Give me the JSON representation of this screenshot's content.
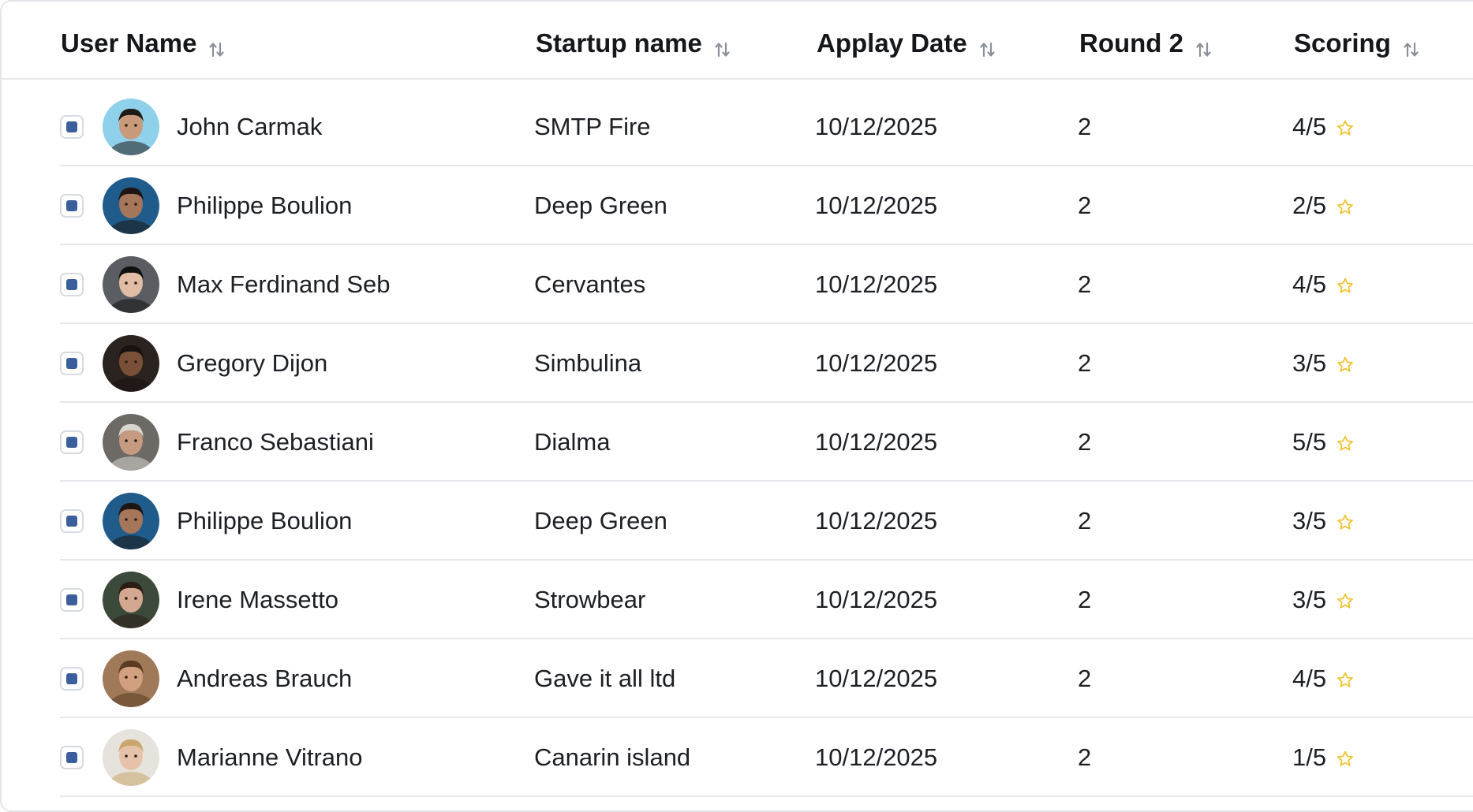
{
  "table": {
    "columns": [
      {
        "key": "user",
        "label": "User Name"
      },
      {
        "key": "startup",
        "label": "Startup name"
      },
      {
        "key": "date",
        "label": "Applay Date"
      },
      {
        "key": "round",
        "label": "Round 2"
      },
      {
        "key": "scoring",
        "label": "Scoring"
      }
    ],
    "rows": [
      {
        "name": "John Carmak",
        "startup": "SMTP Fire",
        "date": "10/12/2025",
        "round": "2",
        "score": "4/5",
        "avatar": {
          "bg": "#8fd0ea",
          "skin": "#c99a7a",
          "hair": "#1e1a17"
        }
      },
      {
        "name": "Philippe Boulion",
        "startup": "Deep Green",
        "date": "10/12/2025",
        "round": "2",
        "score": "2/5",
        "avatar": {
          "bg": "#1f5c8c",
          "skin": "#a6765a",
          "hair": "#1c1512"
        }
      },
      {
        "name": "Max Ferdinand Seb",
        "startup": "Cervantes",
        "date": "10/12/2025",
        "round": "2",
        "score": "4/5",
        "avatar": {
          "bg": "#5a5e62",
          "skin": "#e2bda5",
          "hair": "#111111"
        }
      },
      {
        "name": "Gregory Dijon",
        "startup": "Simbulina",
        "date": "10/12/2025",
        "round": "2",
        "score": "3/5",
        "avatar": {
          "bg": "#2a2320",
          "skin": "#7a5038",
          "hair": "#1a1210"
        }
      },
      {
        "name": "Franco Sebastiani",
        "startup": "Dialma",
        "date": "10/12/2025",
        "round": "2",
        "score": "5/5",
        "avatar": {
          "bg": "#6d6a66",
          "skin": "#c49a80",
          "hair": "#d8d4cf"
        }
      },
      {
        "name": "Philippe Boulion",
        "startup": "Deep Green",
        "date": "10/12/2025",
        "round": "2",
        "score": "3/5",
        "avatar": {
          "bg": "#1f5c8c",
          "skin": "#a6765a",
          "hair": "#1c1512"
        }
      },
      {
        "name": "Irene Massetto",
        "startup": "Strowbear",
        "date": "10/12/2025",
        "round": "2",
        "score": "3/5",
        "avatar": {
          "bg": "#3c4a3c",
          "skin": "#d4a890",
          "hair": "#2b1c14"
        }
      },
      {
        "name": "Andreas Brauch",
        "startup": "Gave it all ltd",
        "date": "10/12/2025",
        "round": "2",
        "score": "4/5",
        "avatar": {
          "bg": "#a07a58",
          "skin": "#d2a07e",
          "hair": "#5a3a22"
        }
      },
      {
        "name": "Marianne Vitrano",
        "startup": "Canarin island",
        "date": "10/12/2025",
        "round": "2",
        "score": "1/5",
        "avatar": {
          "bg": "#e6e2dc",
          "skin": "#e6c2a8",
          "hair": "#c9a66e"
        }
      }
    ]
  },
  "colors": {
    "checkbox_fill": "#3b5f9c",
    "star": "#f2c230",
    "divider": "#e5e7ea"
  },
  "icons": {
    "sort": "sort-arrows-icon",
    "star": "star-outline-icon",
    "checkbox": "checkbox-checked"
  }
}
